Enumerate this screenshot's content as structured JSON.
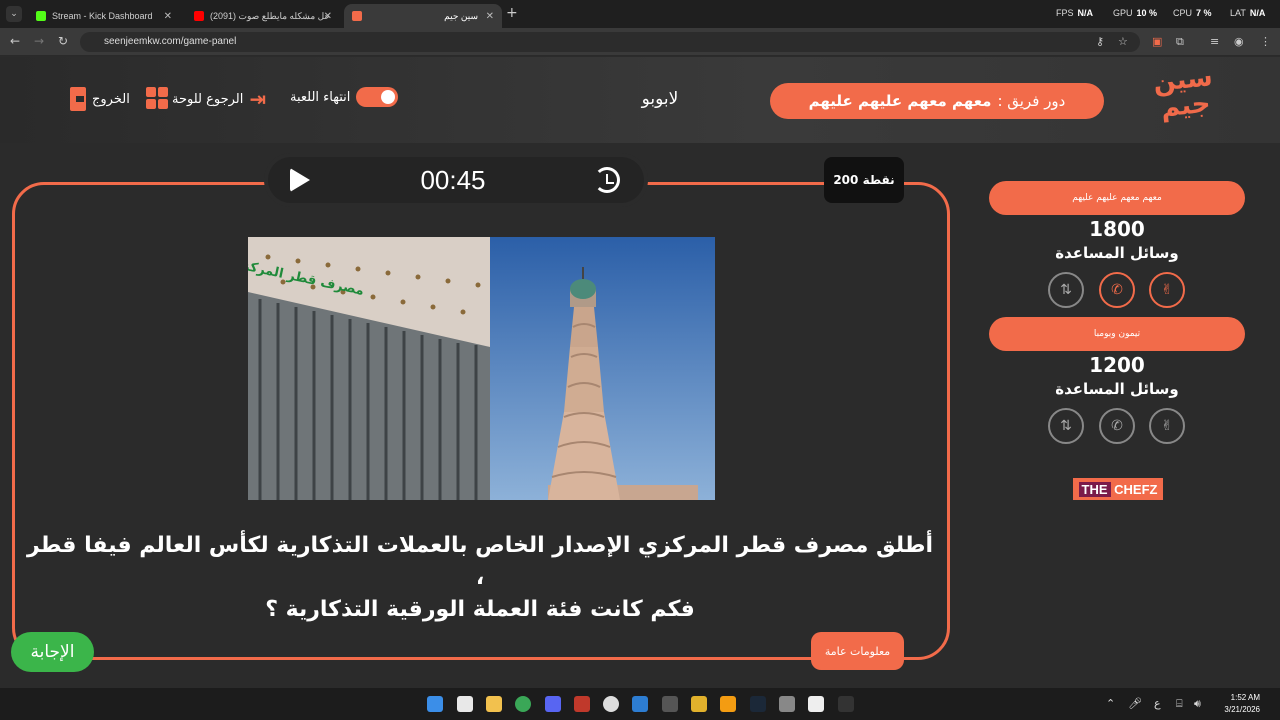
{
  "browser": {
    "tabs": [
      {
        "label": "Stream - Kick Dashboard",
        "color": "#53fc18"
      },
      {
        "label": "(2091) حل مشكله مايطلع صوت",
        "color": "#ff0000"
      },
      {
        "label": "سين جيم",
        "color": "#f26b4a"
      }
    ],
    "url": "seenjeemkw.com/game-panel",
    "sysmon": {
      "fps_label": "FPS",
      "fps_value": "N/A",
      "gpu_label": "GPU",
      "gpu_value": "10 %",
      "cpu_label": "CPU",
      "cpu_value": "7 %",
      "lat_label": "LAT",
      "lat_value": "N/A"
    }
  },
  "header": {
    "logo_text": "سين جيم",
    "turn_prefix": "دور فريق :",
    "turn_team": "معهم معهم عليهم عليهم",
    "game_name": "لابوبو",
    "end_game_label": "انتهاء اللعبة",
    "back_label": "الرجوع للوحة",
    "exit_label": "الخروج"
  },
  "question": {
    "timer": "00:45",
    "points": "200 نقطة",
    "line1": "أطلق مصرف قطر المركزي الإصدار الخاص بالعملات التذكارية لكأس العالم فيفا قطر ،",
    "line2": "فكم كانت فئة العملة الورقية التذكارية ؟",
    "image_sign": "مصرف قطر المركزي",
    "category": "معلومات عامة",
    "answer_label": "الإجابة"
  },
  "teams": [
    {
      "name": "معهم معهم عليهم عليهم",
      "score": "1800",
      "aids_label": "وسائل المساعدة"
    },
    {
      "name": "تيمون وبومبا",
      "score": "1200",
      "aids_label": "وسائل المساعدة"
    }
  ],
  "sponsor": {
    "brand_a": "THE",
    "brand_b": "CHEFZ"
  },
  "taskbar": {
    "time": "1:52 AM",
    "date": "3/21/2026",
    "lang": "ع"
  },
  "colors": {
    "accent": "#f26b4a",
    "answer": "#3bb54a",
    "bg": "#2b2b2b"
  }
}
